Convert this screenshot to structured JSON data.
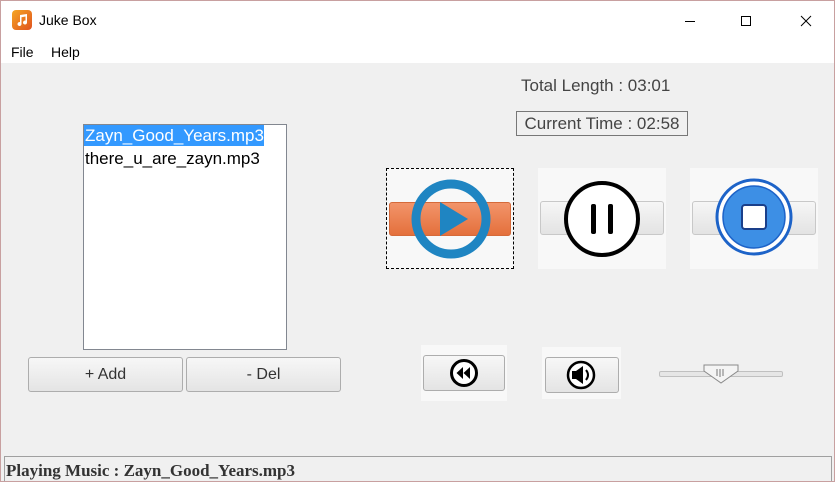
{
  "window": {
    "title": "Juke Box",
    "icon": "music-note-icon",
    "controls": [
      "minimize-icon",
      "maximize-icon",
      "close-icon"
    ]
  },
  "menu": {
    "file": "File",
    "help": "Help"
  },
  "playlist": {
    "items": [
      "Zayn_Good_Years.mp3",
      "there_u_are_zayn.mp3"
    ],
    "selected_index": 0
  },
  "buttons": {
    "add": "+ Add",
    "del": "- Del"
  },
  "time": {
    "total_label": "Total Length : 03:01",
    "current_label": "Current Time : 02:58"
  },
  "controls": {
    "play": "play-icon",
    "pause": "pause-icon",
    "stop": "stop-icon",
    "rewind": "rewind-icon",
    "sound": "speaker-icon"
  },
  "volume": {
    "level": 0.5
  },
  "colors": {
    "selection": "#3399ff",
    "play_accent": "#e4703c",
    "play_ring": "#1f85c2",
    "stop_fill": "#3d8fe5"
  },
  "status": {
    "text": "Playing Music : Zayn_Good_Years.mp3"
  }
}
